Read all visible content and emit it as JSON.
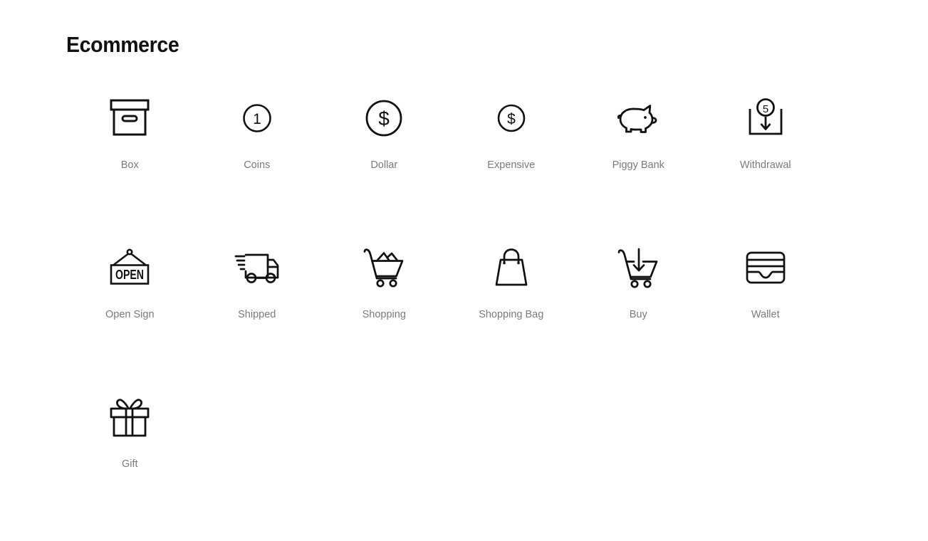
{
  "page": {
    "title": "Ecommerce",
    "background_color": "#ffffff",
    "title_color": "#111111",
    "label_color": "#7b7b7b",
    "icon_stroke_color": "#111111"
  },
  "icons": [
    {
      "label": "Box",
      "icon_name": "box-icon"
    },
    {
      "label": "Coins",
      "icon_name": "coins-icon",
      "glyph_text": "1"
    },
    {
      "label": "Dollar",
      "icon_name": "dollar-icon",
      "glyph_text": "$"
    },
    {
      "label": "Expensive",
      "icon_name": "expensive-icon",
      "glyph_text": "$"
    },
    {
      "label": "Piggy Bank",
      "icon_name": "piggy-bank-icon"
    },
    {
      "label": "Withdrawal",
      "icon_name": "withdrawal-icon",
      "glyph_text": "5"
    },
    {
      "label": "Open Sign",
      "icon_name": "open-sign-icon",
      "glyph_text": "OPEN"
    },
    {
      "label": "Shipped",
      "icon_name": "shipped-truck-icon"
    },
    {
      "label": "Shopping",
      "icon_name": "shopping-cart-icon"
    },
    {
      "label": "Shopping Bag",
      "icon_name": "shopping-bag-icon"
    },
    {
      "label": "Buy",
      "icon_name": "buy-cart-icon"
    },
    {
      "label": "Wallet",
      "icon_name": "wallet-icon"
    },
    {
      "label": "Gift",
      "icon_name": "gift-icon"
    }
  ]
}
